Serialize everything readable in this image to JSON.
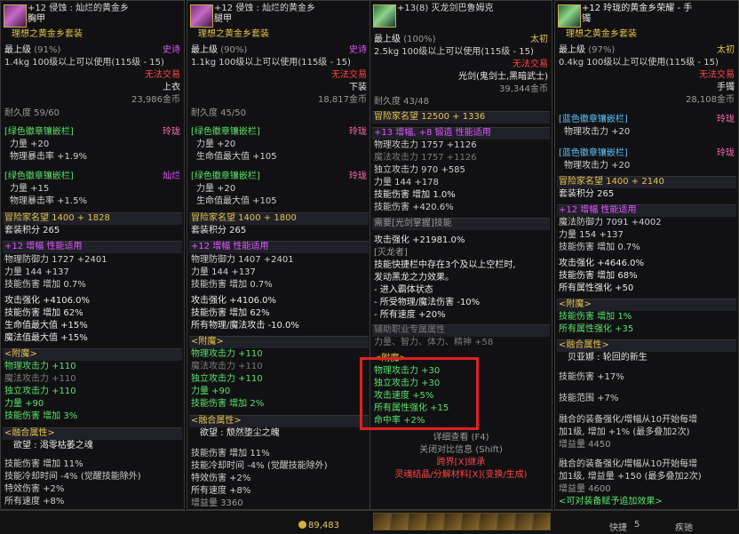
{
  "panel1": {
    "header_line1": "+12 侵蚀 : 灿烂的黄金乡",
    "header_line2": "胸甲",
    "set": "理想之黄金乡套装",
    "level": "最上级",
    "pct": "(91%)",
    "rarity": "史诗",
    "weight": "1.4kg",
    "req": "100级以上可以使用(115级 - 15)",
    "trade": "无法交易",
    "slot": "上衣",
    "price": "23,986金币",
    "durability": "耐久度 59/60",
    "emb1_title": "[绿色徽章镶嵌栏]",
    "emb1_tag": "玲珑",
    "emb1_a": "力量 +20",
    "emb1_b": "物理暴击率 +1.9%",
    "emb2_title": "[绿色徽章镶嵌栏]",
    "emb2_tag": "灿烂",
    "emb2_a": "力量 +15",
    "emb2_b": "物理暴击率 +1.5%",
    "fame": "冒险家名望 1400 + 1828",
    "set_score": "套装积分 265",
    "amp_title": "+12 增幅 性能适用",
    "stat1": "物理防御力 1727 +2401",
    "stat2": "力量 144 +137",
    "stat3": "技能伤害 增加 0.7%",
    "stat4": "攻击强化 +4106.0%",
    "stat5": "技能伤害 增加 62%",
    "stat6": "生命值最大值 +15%",
    "stat7": "魔法值最大值 +15%",
    "ench_title": "<附魔>",
    "ench1": "物理攻击力 +110",
    "ench2": "魔法攻击力 +110",
    "ench3": "独立攻击力 +110",
    "ench4": "力量 +90",
    "ench5": "技能伤害 增加 3%",
    "fusion_title": "<融合属性>",
    "fusion_name": "欲望 : 渴零枯萎之魂",
    "f1": "技能伤害 增加 11%",
    "f2": "技能冷却时间 -4% (觉醒技能除外)",
    "f3": "特效伤害 +2%",
    "f4": "所有速度 +8%"
  },
  "panel2": {
    "header_line1": "+12 侵蚀 : 灿烂的黄金乡",
    "header_line2": "腿甲",
    "set": "理想之黄金乡套装",
    "level": "最上级",
    "pct": "(90%)",
    "rarity": "史诗",
    "weight": "1.1kg",
    "req": "100级以上可以使用(115级 - 15)",
    "trade": "无法交易",
    "slot": "下装",
    "price": "18,817金币",
    "durability": "耐久度 45/50",
    "emb1_title": "[绿色徽章镶嵌栏]",
    "emb1_tag": "玲珑",
    "emb1_a": "力量 +20",
    "emb1_b": "生命值最大值 +105",
    "emb2_title": "[绿色徽章镶嵌栏]",
    "emb2_tag": "玲珑",
    "emb2_a": "力量 +20",
    "emb2_b": "生命值最大值 +105",
    "fame": "冒险家名望 1400 + 1800",
    "set_score": "套装积分 265",
    "amp_title": "+12 增幅 性能适用",
    "stat1": "物理防御力 1407 +2401",
    "stat2": "力量 144 +137",
    "stat3": "技能伤害 增加 0.7%",
    "stat4": "攻击强化 +4106.0%",
    "stat5": "技能伤害 增加 62%",
    "stat6": "所有物理/魔法攻击 -10.0%",
    "ench_title": "<附魔>",
    "ench1": "物理攻击力 +110",
    "ench2": "魔法攻击力 +110",
    "ench3": "独立攻击力 +110",
    "ench4": "力量 +90",
    "ench5": "技能伤害 增加 2%",
    "fusion_title": "<融合属性>",
    "fusion_name": "欲望 : 颓然堕尘之魄",
    "f1": "技能伤害 增加 11%",
    "f2": "技能冷却时间 -4% (觉醒技能除外)",
    "f3": "特效伤害 +2%",
    "f4": "所有速度 +8%",
    "f5": "增益量 3360"
  },
  "panel3": {
    "header_line1": "+13(8) 灭龙剑巴鲁姆克",
    "level": "最上级",
    "pct": "(100%)",
    "rarity": "太初",
    "weight": "2.5kg",
    "req": "100级以上可以使用(115级 - 15)",
    "trade": "无法交易",
    "cls": "光剑(鬼剑士,黑暗武士)",
    "price": "39,344金币",
    "durability": "耐久度 43/48",
    "fame": "冒险家名望 12500 + 1336",
    "amp_title": "+13 增幅, +8 锻造 性能适用",
    "s1": "物理攻击力 1757 +1126",
    "s2": "魔法攻击力 1757 +1126",
    "s3": "独立攻击力 970 +585",
    "s4": "力量 144 +178",
    "s5": "技能伤害 增加 1.0%",
    "s6": "技能伤害 +420.6%",
    "need": "需要[光剑掌握]技能",
    "atk": "攻击强化 +21981.0%",
    "dragon": "[灭龙者]",
    "d1": "技能快捷栏中存在3个及以上空栏时,",
    "d2": "发动黑龙之力效果。",
    "d3": "- 进入霸体状态",
    "d4": "- 所受物理/魔法伤害 -10%",
    "d5": "- 所有速度 +20%",
    "aux": "辅助职业专属属性",
    "aux2": "力量、智力、体力、精神 +58",
    "ench_title": "<附魔>",
    "e1": "物理攻击力 +30",
    "e2": "独立攻击力 +30",
    "e3": "攻击速度 +5%",
    "e4": "所有属性强化 +15",
    "e5": "命中率 +2%",
    "detail": "详细查看 (F4)",
    "close": "关闭对比信息 (Shift)",
    "cross": "跨界[X]继承",
    "soul": "灵魂结晶/分解材料[X](变换/生成)"
  },
  "panel4": {
    "header_line1": "+12 玲珑的黄金乡荣耀 - 手",
    "header_line2": "镯",
    "set": "理想之黄金乡套装",
    "level": "最上级",
    "pct": "(97%)",
    "rarity": "太初",
    "weight": "0.4kg",
    "req": "100级以上可以使用(115级 - 15)",
    "trade": "无法交易",
    "slot": "手镯",
    "price": "28,108金币",
    "emb1_title": "[蓝色徽章镶嵌栏]",
    "emb1_tag": "玲珑",
    "emb1_a": "物理攻击力 +20",
    "emb2_title": "[蓝色徽章镶嵌栏]",
    "emb2_tag": "玲珑",
    "emb2_a": "物理攻击力 +20",
    "fame": "冒险家名望 1400 + 2140",
    "set_score": "套装积分 265",
    "amp_title": "+12 增幅 性能适用",
    "s1": "魔法防御力 7091 +4002",
    "s2": "力量 154 +137",
    "s3": "技能伤害 增加 0.7%",
    "s4": "攻击强化 +4646.0%",
    "s5": "技能伤害 增加 68%",
    "s6": "所有属性强化 +50",
    "ench_title": "<附魔>",
    "e1": "技能伤害 增加 1%",
    "e2": "所有属性强化 +35",
    "fusion_title": "<融合属性>",
    "fusion_name": "贝亚娜 : 轮回的新生",
    "f1": "技能伤害 +17%",
    "f2": "技能范围 +7%",
    "f3": "融合的装备强化/增幅从10开始每增",
    "f4": "加1级, 增加 +1% (最多叠加2次)",
    "f5": "增益量 4450",
    "f6": "融合的装备强化/增幅从10开始每增",
    "f7": "加1级, 增益量 +150 (最多叠加2次)",
    "f8": "增益量 4600",
    "footer": "<可对装备赋予追加效果>"
  },
  "bottom": {
    "gold": "89,483",
    "label_a": "快捷",
    "label_b": "5",
    "label_c": "疾驰"
  }
}
